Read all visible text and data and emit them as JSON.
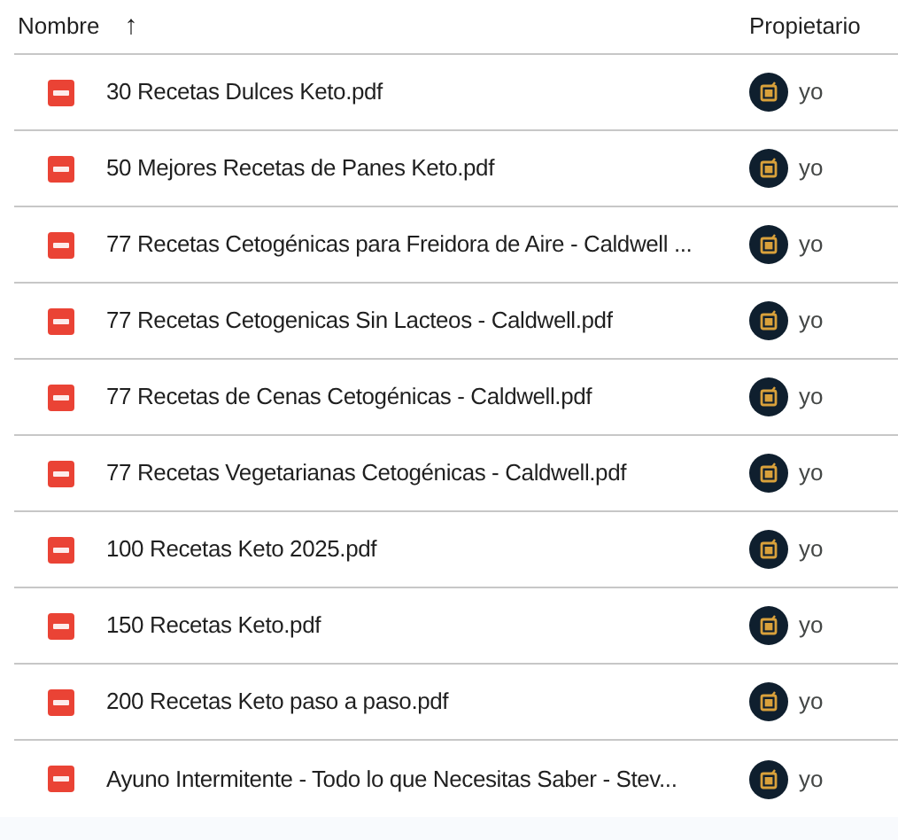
{
  "header": {
    "name_label": "Nombre",
    "sort_arrow": "↑",
    "owner_label": "Propietario"
  },
  "files": [
    {
      "name": "30 Recetas Dulces Keto.pdf",
      "owner": "yo"
    },
    {
      "name": "50 Mejores Recetas de Panes Keto.pdf",
      "owner": "yo"
    },
    {
      "name": "77 Recetas Cetogénicas para Freidora de Aire - Caldwell ...",
      "owner": "yo"
    },
    {
      "name": "77 Recetas Cetogenicas Sin Lacteos - Caldwell.pdf",
      "owner": "yo"
    },
    {
      "name": "77 Recetas de Cenas Cetogénicas - Caldwell.pdf",
      "owner": "yo"
    },
    {
      "name": "77 Recetas Vegetarianas Cetogénicas - Caldwell.pdf",
      "owner": "yo"
    },
    {
      "name": "100 Recetas Keto 2025.pdf",
      "owner": "yo"
    },
    {
      "name": "150 Recetas Keto.pdf",
      "owner": "yo"
    },
    {
      "name": "200 Recetas Keto paso a paso.pdf",
      "owner": "yo"
    },
    {
      "name": "Ayuno Intermitente - Todo lo que Necesitas Saber - Stev...",
      "owner": "yo"
    }
  ]
}
